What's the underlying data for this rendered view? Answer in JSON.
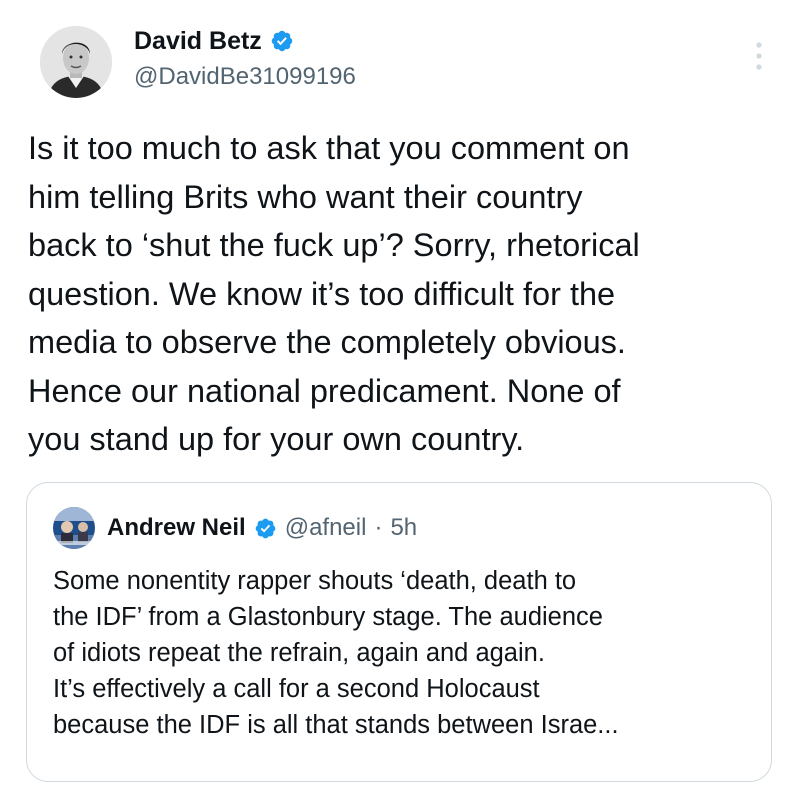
{
  "author": {
    "name": "David Betz",
    "handle": "@DavidBe31099196",
    "verified": true,
    "avatar_icon": "person-portrait-avatar"
  },
  "more_icon": "vertical-ellipsis-icon",
  "tweet_text": "Is it too much to ask that you comment on\nhim telling Brits who want their country\nback to ‘shut the fuck up’? Sorry, rhetorical\nquestion. We know it’s too difficult for the\nmedia to observe the completely obvious.\nHence our national predicament. None of\nyou stand up for your own country.",
  "quoted_tweet": {
    "name": "Andrew Neil",
    "handle": "@afneil",
    "separator": "·",
    "time": "5h",
    "verified": true,
    "text": "Some nonentity rapper shouts ‘death, death to\nthe IDF’ from a Glastonbury stage. The audience\nof idiots repeat the refrain, again and again.\nIt’s effectively a call for a second Holocaust\nbecause the IDF is all that stands between Israe..."
  },
  "colors": {
    "text_primary": "#0f1419",
    "text_secondary": "#536471",
    "verified_blue": "#1d9bf0",
    "border": "#cfd9de"
  }
}
